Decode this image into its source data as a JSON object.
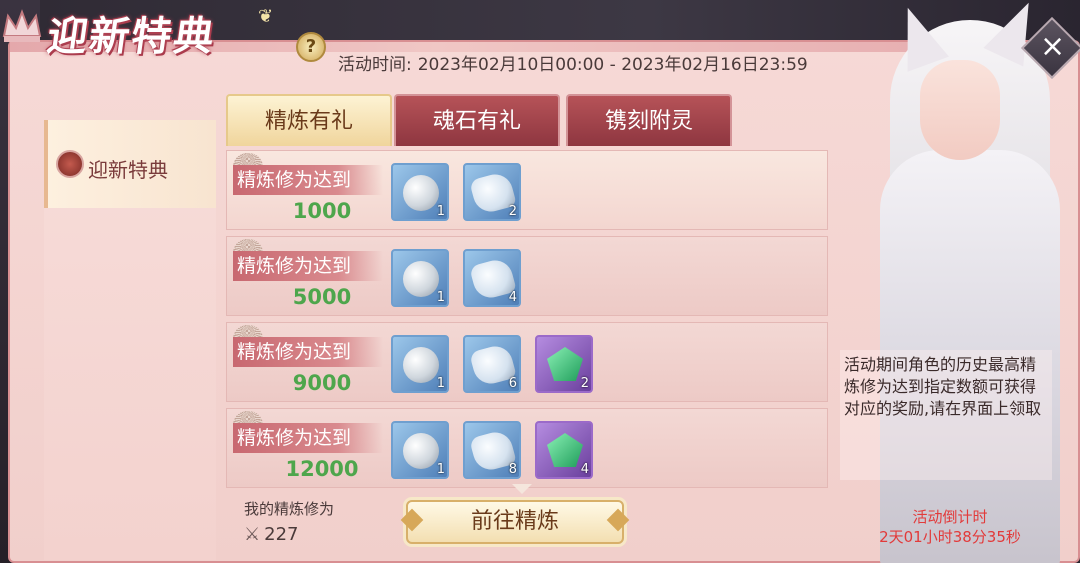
{
  "header": {
    "title": "迎新特典",
    "event_time_label": "活动时间:",
    "event_time_value": "2023年02月10日00:00 - 2023年02月16日23:59"
  },
  "sidebar": {
    "items": [
      {
        "label": "迎新特典",
        "active": true
      }
    ]
  },
  "tabs": [
    {
      "label": "精炼有礼",
      "active": true
    },
    {
      "label": "魂石有礼",
      "active": false
    },
    {
      "label": "镌刻附灵",
      "active": false
    }
  ],
  "rows": [
    {
      "requirement": "精炼修为达到",
      "amount": "1000",
      "rewards": [
        {
          "icon": "silver-coin-icon",
          "count": "1"
        },
        {
          "icon": "white-jade-icon",
          "count": "2"
        }
      ]
    },
    {
      "requirement": "精炼修为达到",
      "amount": "5000",
      "rewards": [
        {
          "icon": "silver-coin-icon",
          "count": "1"
        },
        {
          "icon": "white-jade-icon",
          "count": "4"
        }
      ]
    },
    {
      "requirement": "精炼修为达到",
      "amount": "9000",
      "rewards": [
        {
          "icon": "silver-coin-icon",
          "count": "1"
        },
        {
          "icon": "white-jade-icon",
          "count": "6"
        },
        {
          "icon": "emerald-gem-icon",
          "count": "2"
        }
      ]
    },
    {
      "requirement": "精炼修为达到",
      "amount": "12000",
      "rewards": [
        {
          "icon": "silver-coin-icon",
          "count": "1"
        },
        {
          "icon": "white-jade-icon",
          "count": "8"
        },
        {
          "icon": "emerald-gem-icon",
          "count": "4"
        }
      ]
    }
  ],
  "footer": {
    "my_refine_label": "我的精炼修为",
    "my_refine_value": "227",
    "goto_button": "前往精炼"
  },
  "info_text": "活动期间角色的历史最高精炼修为达到指定数额可获得对应的奖励,请在界面上领取",
  "countdown": {
    "title": "活动倒计时",
    "value": "2天01小时38分35秒"
  },
  "colors": {
    "amount_green": "#4ea64c",
    "countdown_red": "#e23a3a",
    "tab_active": "#f0d59c",
    "tab_inactive": "#8e3640"
  }
}
